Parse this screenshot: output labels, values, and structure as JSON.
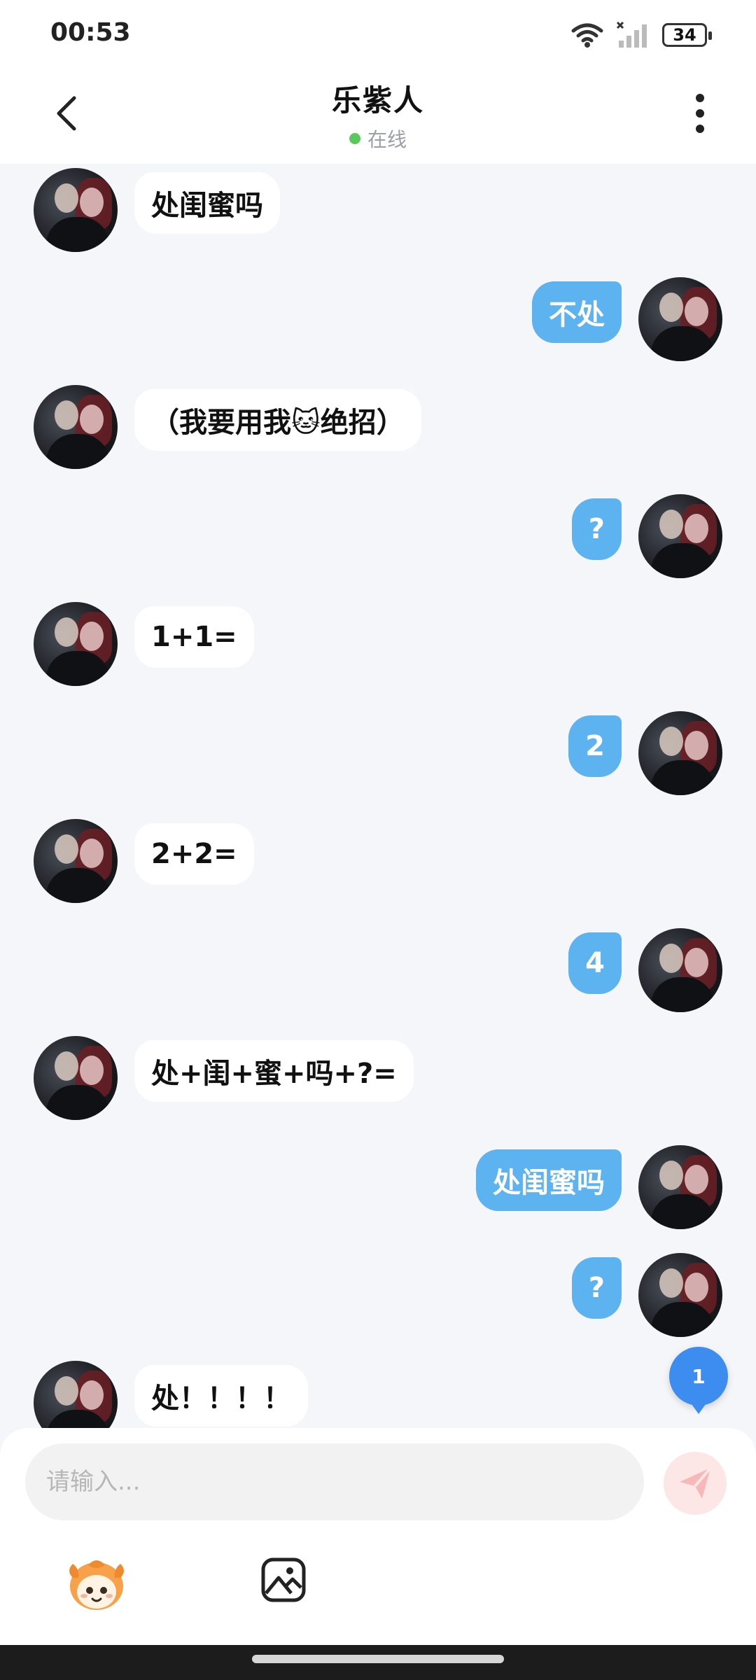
{
  "status_bar": {
    "time": "00:53",
    "battery": "34"
  },
  "header": {
    "title": "乐紫人",
    "status": "在线"
  },
  "messages": [
    {
      "side": "left",
      "text": "处闺蜜吗"
    },
    {
      "side": "right",
      "text": "不处"
    },
    {
      "side": "left",
      "text": "（我要用我🐱绝招）"
    },
    {
      "side": "right",
      "text": "?"
    },
    {
      "side": "left",
      "text": "1+1="
    },
    {
      "side": "right",
      "text": "2"
    },
    {
      "side": "left",
      "text": "2+2="
    },
    {
      "side": "right",
      "text": "4"
    },
    {
      "side": "left",
      "text": "处+闺+蜜+吗+?="
    },
    {
      "side": "right",
      "text": "处闺蜜吗"
    },
    {
      "side": "right",
      "text": "?"
    },
    {
      "side": "left",
      "text": "处！！！！"
    }
  ],
  "unread_badge": "1",
  "composer": {
    "placeholder": "请输入..."
  },
  "colors": {
    "own_bubble": "#5db2f0",
    "other_bubble": "#ffffff",
    "background": "#f4f6f9",
    "online": "#5ac85a",
    "unread": "#3d8cf0"
  },
  "icons": {
    "back": "chevron-left-icon",
    "more": "more-vertical-icon",
    "send": "send-icon",
    "emoji": "mascot-emoji-icon",
    "image": "image-icon"
  }
}
